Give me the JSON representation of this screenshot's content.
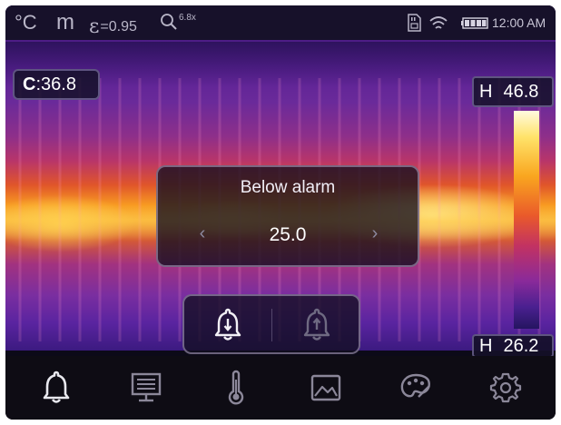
{
  "status_bar": {
    "unit": "°C",
    "distance_unit": "m",
    "emissivity_symbol": "ε",
    "emissivity_value": "=0.95",
    "zoom_icon": "magnifier-icon",
    "zoom_value": "6.8x",
    "sd_icon": "sd-card-icon",
    "wifi_icon": "wifi-icon",
    "battery_icon": "battery-icon",
    "time": "12:00 AM"
  },
  "readouts": {
    "center_label": "C",
    "center_value": ":36.8",
    "high_label": "H",
    "high_value": "46.8",
    "low_label": "H",
    "low_value": "26.2"
  },
  "alarm_dialog": {
    "title": "Below alarm",
    "value": "25.0",
    "left_arrow": "‹",
    "right_arrow": "›"
  },
  "alarm_modes": [
    {
      "icon": "bell-down-icon",
      "selected": true
    },
    {
      "icon": "bell-up-icon",
      "selected": false
    }
  ],
  "toolbar": [
    {
      "icon": "bell-icon",
      "active": true
    },
    {
      "icon": "monitor-icon",
      "active": false
    },
    {
      "icon": "thermometer-icon",
      "active": false
    },
    {
      "icon": "image-icon",
      "active": false
    },
    {
      "icon": "palette-icon",
      "active": false
    },
    {
      "icon": "gear-icon",
      "active": false
    }
  ],
  "colors": {
    "toolbar_icon_active": "#e8e8ee",
    "toolbar_icon_inactive": "#8b8799",
    "dialog_bg": "#120e20"
  }
}
